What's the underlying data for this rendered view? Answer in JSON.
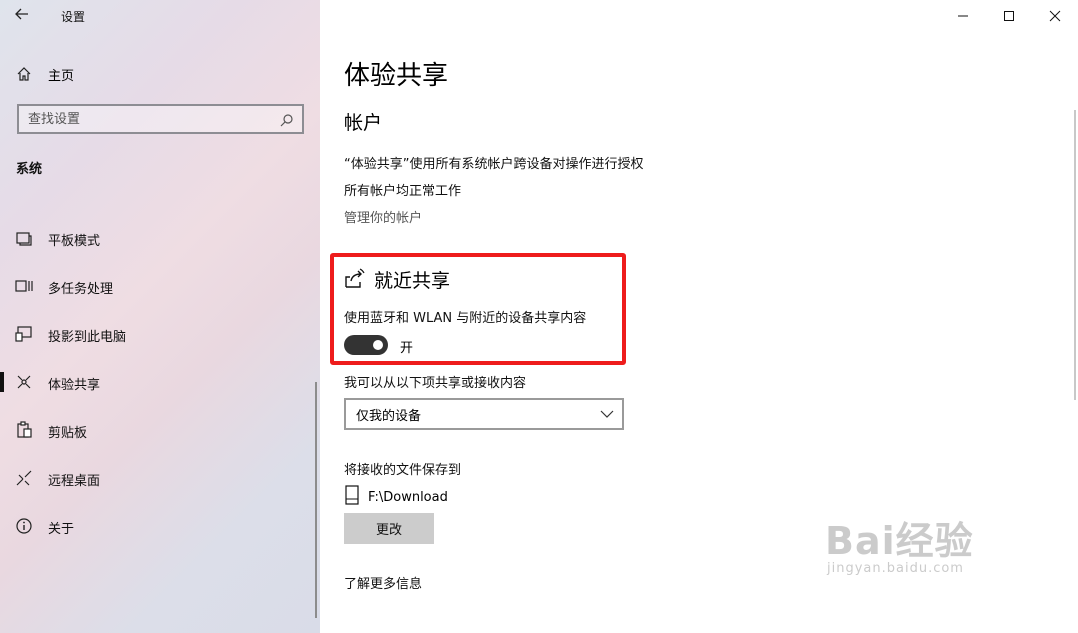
{
  "window": {
    "title": "设置",
    "controls": [
      "minimize-icon",
      "maximize-icon",
      "close-icon"
    ]
  },
  "sidebar": {
    "home_label": "主页",
    "search_placeholder": "查找设置",
    "section": "系统",
    "items": [
      {
        "label": "平板模式",
        "icon": "tablet-mode-icon",
        "active": false
      },
      {
        "label": "多任务处理",
        "icon": "multitasking-icon",
        "active": false
      },
      {
        "label": "投影到此电脑",
        "icon": "project-icon",
        "active": false
      },
      {
        "label": "体验共享",
        "icon": "shared-experiences-icon",
        "active": true
      },
      {
        "label": "剪贴板",
        "icon": "clipboard-icon",
        "active": false
      },
      {
        "label": "远程桌面",
        "icon": "remote-desktop-icon",
        "active": false
      },
      {
        "label": "关于",
        "icon": "info-icon",
        "active": false
      }
    ]
  },
  "main": {
    "page_title": "体验共享",
    "accounts": {
      "heading": "帐户",
      "line1": "“体验共享”使用所有系统帐户跨设备对操作进行授权",
      "line2": "所有帐户均正常工作",
      "manage_link": "管理你的帐户"
    },
    "nearby": {
      "heading": "就近共享",
      "description": "使用蓝牙和 WLAN 与附近的设备共享内容",
      "toggle_state": "开",
      "toggle_on": true
    },
    "share_from": {
      "label": "我可以从以下项共享或接收内容",
      "selected": "仅我的设备"
    },
    "save_to": {
      "label": "将接收的文件保存到",
      "path": "F:\\Download",
      "change_button": "更改"
    },
    "more_info": "了解更多信息"
  },
  "watermark": {
    "brand": "Bai经验",
    "url": "jingyan.baidu.com"
  },
  "colors": {
    "highlight_box": "#ee1c1c",
    "toggle_on": "#333333"
  }
}
